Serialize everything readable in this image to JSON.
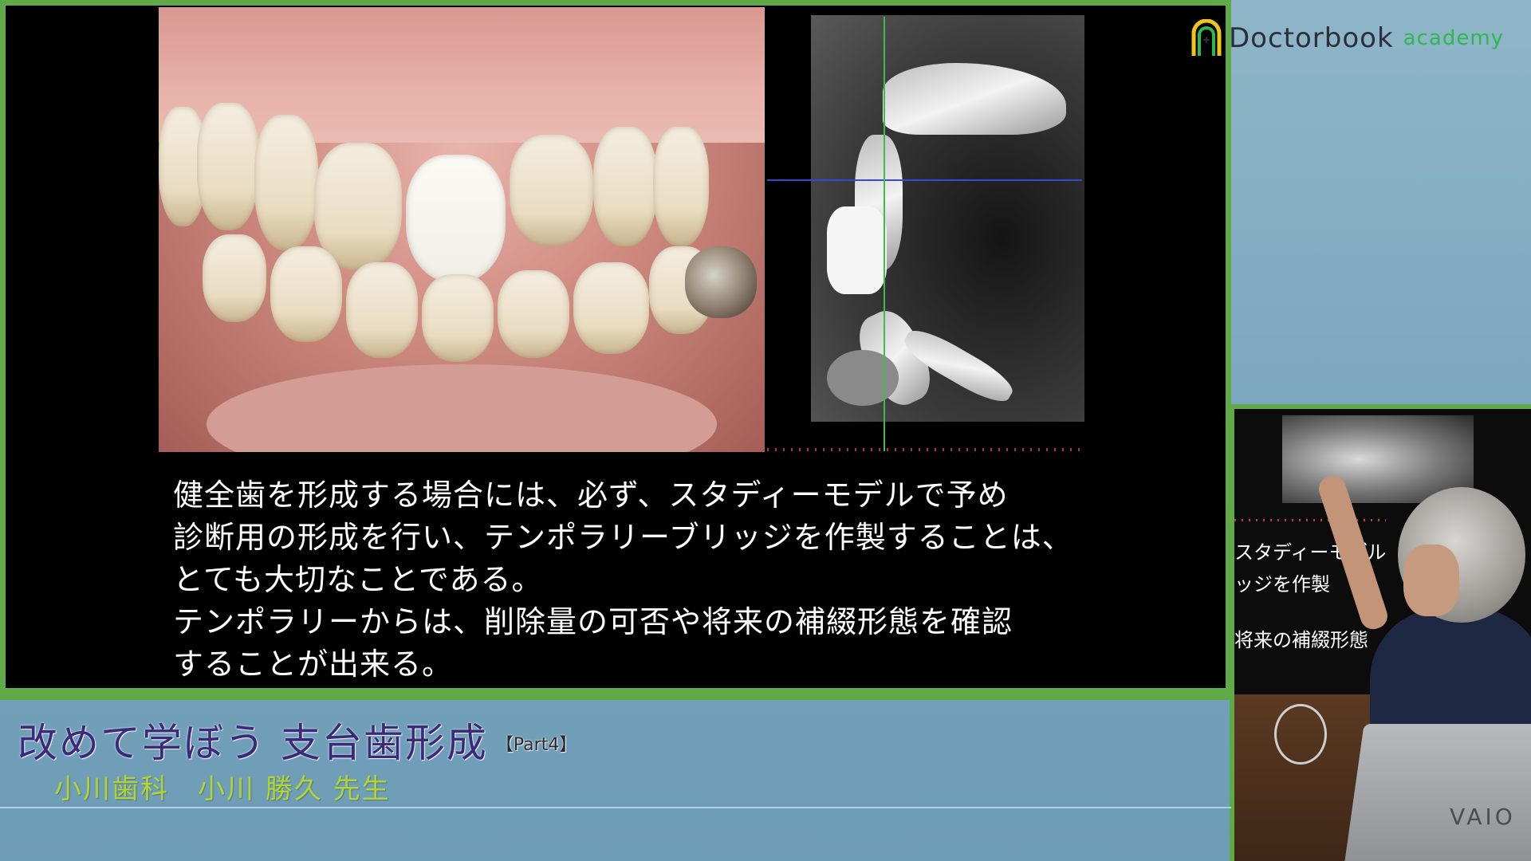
{
  "brand": {
    "name": "Doctorbook",
    "sub": "academy",
    "accent": "#2db94d"
  },
  "slide": {
    "lines": [
      "健全歯を形成する場合には、必ず、スタディーモデルで予め",
      "診断用の形成を行い、テンポラリーブリッジを作製することは、",
      "とても大切なことである。",
      "テンポラリーからは、削除量の可否や将来の補綴形態を確認",
      "することが出来る。"
    ]
  },
  "camera": {
    "screen_lines": [
      "スタディーモデル",
      "ッジを作製",
      "将来の補綴形態"
    ],
    "laptop_logo": "VAIO"
  },
  "lecture": {
    "title": "改めて学ぼう 支台歯形成",
    "part": "【Part4】",
    "clinic": "小川歯科",
    "presenter": "小川 勝久 先生"
  },
  "colors": {
    "frame_green": "#5faa46",
    "title_purple": "#3a2a7a",
    "lecturer_green": "#b3d433"
  }
}
